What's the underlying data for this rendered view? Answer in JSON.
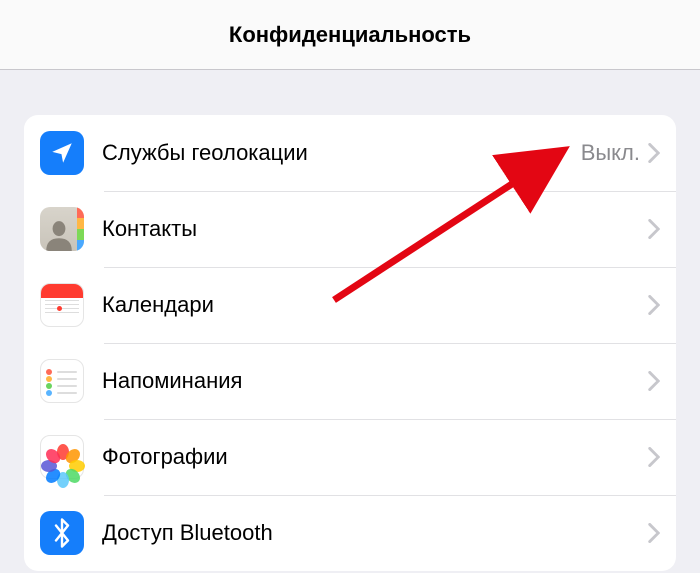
{
  "header": {
    "title": "Конфиденциальность"
  },
  "rows": [
    {
      "label": "Службы геолокации",
      "value": "Выкл."
    },
    {
      "label": "Контакты",
      "value": ""
    },
    {
      "label": "Календари",
      "value": ""
    },
    {
      "label": "Напоминания",
      "value": ""
    },
    {
      "label": "Фотографии",
      "value": ""
    },
    {
      "label": "Доступ Bluetooth",
      "value": ""
    }
  ]
}
